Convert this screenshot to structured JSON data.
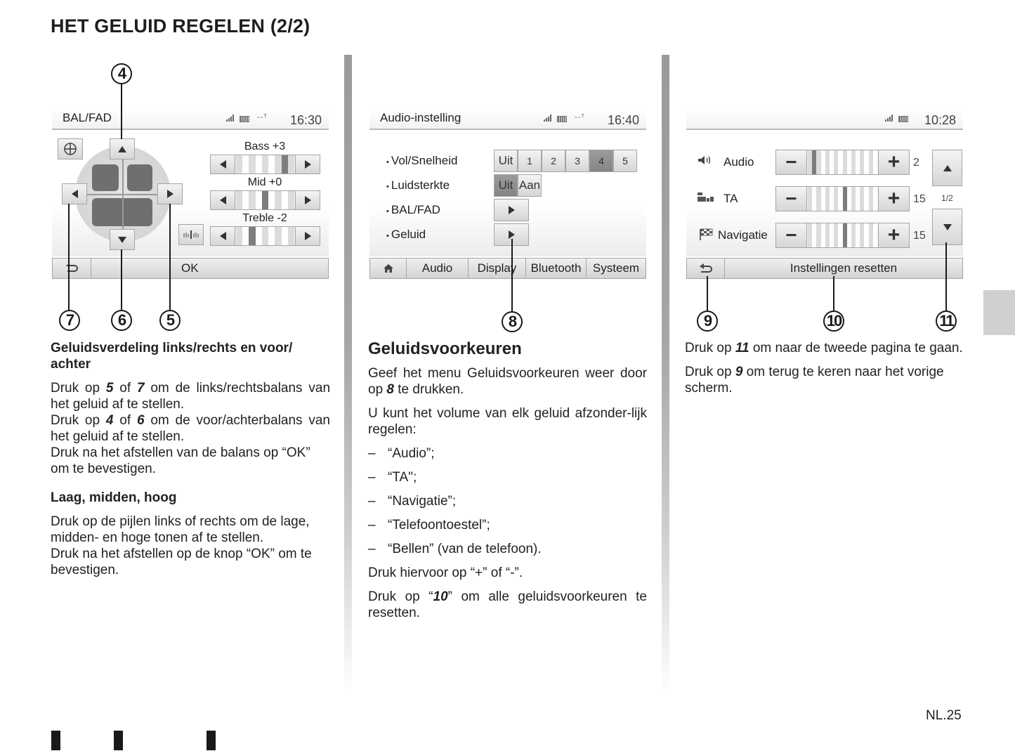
{
  "page": {
    "title": "HET GELUID REGELEN (2/2)",
    "page_number": "NL.25"
  },
  "screen1": {
    "title": "BAL/FAD",
    "time": "16:30",
    "status_icons": [
      "signal-icon",
      "battery-icon",
      "antenna-icon"
    ],
    "center_button_icon": "crosshair-icon",
    "eq": [
      {
        "label": "Bass +3",
        "value": 3
      },
      {
        "label": "Mid +0",
        "value": 0
      },
      {
        "label": "Treble -2",
        "value": -2
      }
    ],
    "eq_range": [
      -4,
      4
    ],
    "eq_preset_icon": "equalizer-icon",
    "back_icon": "back-icon",
    "ok_label": "OK"
  },
  "screen2": {
    "title": "Audio-instelling",
    "time": "16:40",
    "rows": [
      {
        "label": "Vol/Snelheid",
        "options": [
          "Uit",
          "1",
          "2",
          "3",
          "4",
          "5"
        ],
        "selected": "4"
      },
      {
        "label": "Luidsterkte",
        "options": [
          "Uit",
          "Aan"
        ],
        "selected": "Uit"
      },
      {
        "label": "BAL/FAD",
        "action": "play-arrow-icon"
      },
      {
        "label": "Geluid",
        "action": "play-arrow-icon"
      }
    ],
    "tabs": [
      {
        "icon": "home-icon"
      },
      {
        "label": "Audio",
        "active": true
      },
      {
        "label": "Display"
      },
      {
        "label": "Bluetooth"
      },
      {
        "label": "Systeem"
      }
    ]
  },
  "screen3": {
    "time": "10:28",
    "rows": [
      {
        "icon": "speaker-icon",
        "label": "Audio",
        "value": "2",
        "level": 2
      },
      {
        "icon": "traffic-info-icon",
        "label": "TA",
        "value": "15",
        "level": 15
      },
      {
        "icon": "checkered-flag-icon",
        "label": "Navigatie",
        "value": "15",
        "level": 15
      }
    ],
    "level_max": 30,
    "minus_label": "−",
    "plus_label": "+",
    "page_indicator": "1/2",
    "reset_label": "Instellingen resetten",
    "back_icon": "back-icon"
  },
  "callouts": {
    "c4": "4",
    "c5": "5",
    "c6": "6",
    "c7": "7",
    "c8": "8",
    "c9": "9",
    "c10": "10",
    "c11": "11"
  },
  "col1": {
    "heading1": "Geluidsverdeling links/rechts en voor/ achter",
    "p1": [
      {
        "t": "Druk op "
      },
      {
        "b": "5"
      },
      {
        "t": " of "
      },
      {
        "b": "7"
      },
      {
        "t": " om de links/rechtsbalans van het geluid af te stellen."
      }
    ],
    "p2": [
      {
        "t": "Druk op "
      },
      {
        "b": "4"
      },
      {
        "t": " of "
      },
      {
        "b": "6"
      },
      {
        "t": " om de voor/achterbalans van het geluid af te stellen."
      }
    ],
    "p3": "Druk na het afstellen van de balans op “OK” om te bevestigen.",
    "heading2": "Laag, midden, hoog",
    "p4": "Druk op de pijlen links of rechts om de lage, midden- en hoge tonen af te stellen.",
    "p5": "Druk na het afstellen op de knop “OK” om te bevestigen."
  },
  "col2": {
    "heading": "Geluidsvoorkeuren",
    "p1_a": "Geef het menu Geluidsvoorkeuren weer door op ",
    "p1_b": "8",
    "p1_c": " te drukken.",
    "p2": "U kunt het volume van elk geluid afzonder-lijk regelen:",
    "list": [
      "“Audio”;",
      "“TA\";",
      "“Navigatie”;",
      "“Telefoontoestel”;",
      "“Bellen” (van de telefoon)."
    ],
    "dash": "–",
    "p3": "Druk hiervoor op “+” of “-”.",
    "p4_a": "Druk op “",
    "p4_b": "10",
    "p4_c": "” om alle geluidsvoorkeuren te resetten."
  },
  "col3": {
    "p1_a": "Druk op ",
    "p1_b": "11",
    "p1_c": " om naar de tweede pagina te gaan.",
    "p2_a": "Druk op ",
    "p2_b": "9",
    "p2_c": " om terug te keren naar het vorige scherm."
  },
  "colors": {
    "text": "#1e1e1e",
    "divider": "#9a9a9a",
    "side_tab": "#d0d0d0",
    "selected_button": "#8e8e8e"
  }
}
